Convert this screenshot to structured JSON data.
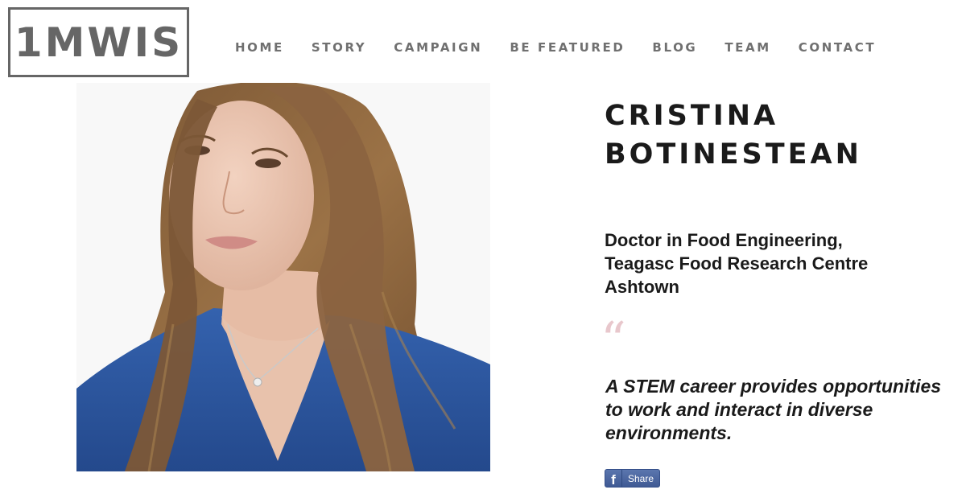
{
  "header": {
    "logo": "1MWIS",
    "nav": [
      {
        "label": "HOME"
      },
      {
        "label": "STORY"
      },
      {
        "label": "CAMPAIGN"
      },
      {
        "label": "BE FEATURED"
      },
      {
        "label": "BLOG"
      },
      {
        "label": "TEAM"
      },
      {
        "label": "CONTACT"
      }
    ]
  },
  "profile": {
    "name_line1": "CRISTINA",
    "name_line2": "BOTINESTEAN",
    "role_line1": "Doctor in Food Engineering,",
    "role_line2": "Teagasc Food Research Centre",
    "role_line3": "Ashtown",
    "quote_mark": "“",
    "quote_line1": "A STEM career provides opportunities",
    "quote_line2": "to work and interact in diverse",
    "quote_line3": "environments."
  },
  "share": {
    "icon": "facebook-icon",
    "icon_glyph": "f",
    "label": "Share"
  },
  "colors": {
    "nav_text": "#707070",
    "heading": "#1a1a1a",
    "quote_mark": "#e8c7cc",
    "facebook": "#4a64a0",
    "hair": "#8a6440",
    "shirt": "#2d56a0"
  }
}
